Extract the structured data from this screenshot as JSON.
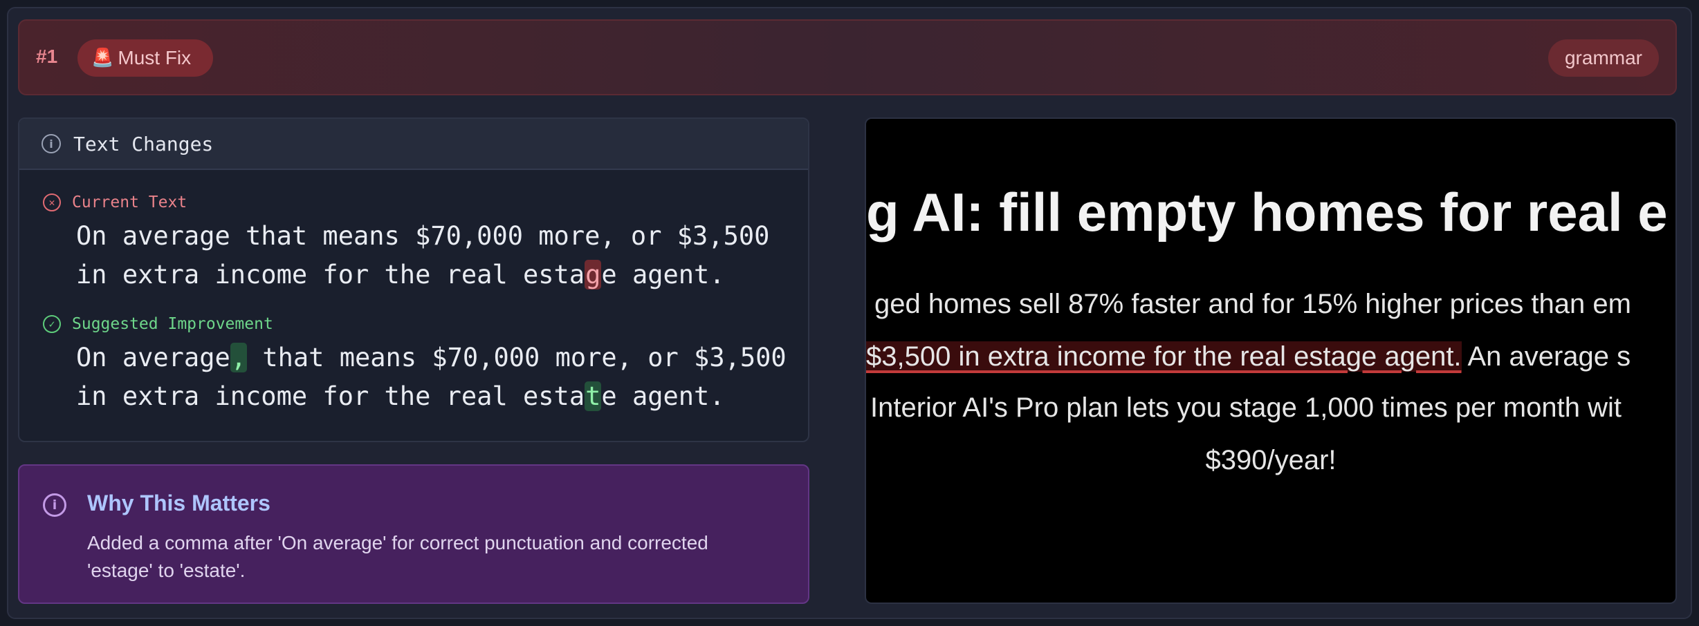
{
  "header": {
    "issue_number": "#1",
    "severity_icon": "🚨",
    "severity_label": "Must Fix",
    "category": "grammar"
  },
  "changes": {
    "title": "Text Changes",
    "current": {
      "label": "Current Text",
      "line1": "On average that means $70,000 more, or $3,500",
      "line2_before": "in extra income for the real esta",
      "line2_highlight": "g",
      "line2_after": "e agent."
    },
    "suggested": {
      "label": "Suggested Improvement",
      "line1_before": "On average",
      "line1_highlight": ",",
      "line1_after": " that means $70,000 more, or $3,500",
      "line2_before": "in extra income for the real esta",
      "line2_highlight": "t",
      "line2_after": "e agent."
    }
  },
  "why": {
    "title": "Why This Matters",
    "body": "Added a comma after 'On average' for correct punctuation and corrected 'estage' to 'estate'."
  },
  "preview": {
    "heading": "g AI: fill empty homes for real e",
    "line1": "ged homes sell 87% faster and for 15% higher prices than em",
    "line2_highlight": "$3,500 in extra income for the real estage agent.",
    "line2_after": " An average s",
    "line3": "Interior AI's Pro plan lets you stage 1,000 times per month wit",
    "line4": "$390/year!"
  },
  "colors": {
    "must_fix": "#7a2a31",
    "current_accent": "#e06a72",
    "suggested_accent": "#5dcc7a",
    "why_bg": "#46215e"
  }
}
